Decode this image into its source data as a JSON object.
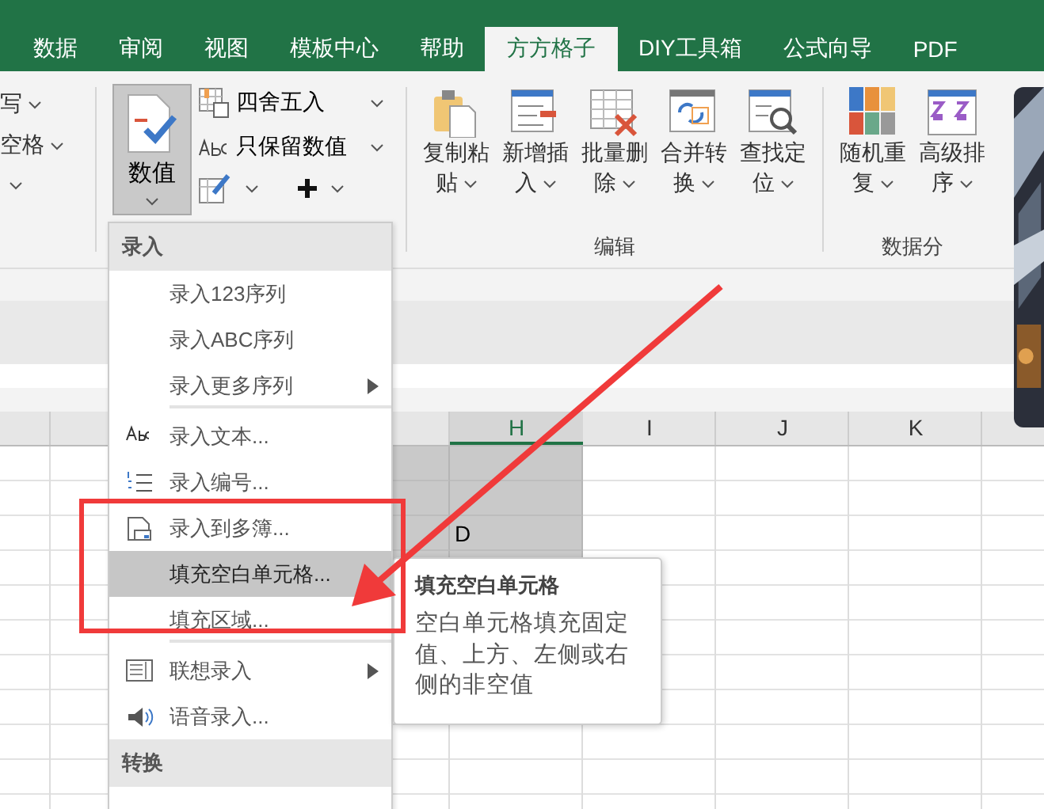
{
  "tabs": [
    {
      "label": "数据",
      "selected": false
    },
    {
      "label": "审阅",
      "selected": false
    },
    {
      "label": "视图",
      "selected": false
    },
    {
      "label": "模板中心",
      "selected": false
    },
    {
      "label": "帮助",
      "selected": false
    },
    {
      "label": "方方格子",
      "selected": true
    },
    {
      "label": "DIY工具箱",
      "selected": false
    },
    {
      "label": "公式向导",
      "selected": false
    },
    {
      "label": "PDF",
      "selected": false
    }
  ],
  "ribbon": {
    "cut_items": [
      "写",
      "空格"
    ],
    "value_button": {
      "label": "数值",
      "pressed": true
    },
    "small_buttons": [
      {
        "label": "四舍五入"
      },
      {
        "label": "只保留数值"
      }
    ],
    "groups": [
      {
        "label": "编辑",
        "buttons": [
          "复制粘贴",
          "新增插入",
          "批量删除",
          "合并转换",
          "查找定位"
        ]
      },
      {
        "label": "数据分",
        "buttons": [
          "随机重复",
          "高级排序"
        ]
      }
    ]
  },
  "grid": {
    "columns": [
      "H",
      "I",
      "J",
      "K"
    ],
    "rows": [
      {
        "selected": true
      },
      {
        "selected": true
      },
      {
        "selected": true,
        "column_h": "D"
      },
      {
        "selected": true
      }
    ]
  },
  "menu": {
    "sections": [
      {
        "title": "录入",
        "items": [
          {
            "label": "录入123序列",
            "kind": "plain",
            "submenu": false,
            "selected": false,
            "separator_after": false
          },
          {
            "label": "录入ABC序列",
            "kind": "plain",
            "submenu": false,
            "selected": false,
            "separator_after": false
          },
          {
            "label": "录入更多序列",
            "kind": "plain",
            "submenu": true,
            "selected": false,
            "separator_after": true
          },
          {
            "label": "录入文本...",
            "kind": "text",
            "submenu": false,
            "selected": false,
            "separator_after": false
          },
          {
            "label": "录入编号...",
            "kind": "numbering",
            "submenu": false,
            "selected": false,
            "separator_after": false
          },
          {
            "label": "录入到多簿...",
            "kind": "workbook",
            "submenu": false,
            "selected": false,
            "separator_after": false
          },
          {
            "label": "填充空白单元格...",
            "kind": "plain",
            "submenu": false,
            "selected": true,
            "separator_after": false
          },
          {
            "label": "填充区域...",
            "kind": "plain",
            "submenu": false,
            "selected": false,
            "separator_after": true
          },
          {
            "label": "联想录入",
            "kind": "association",
            "submenu": true,
            "selected": false,
            "separator_after": false
          },
          {
            "label": "语音录入...",
            "kind": "voice",
            "submenu": false,
            "selected": false,
            "separator_after": false
          }
        ]
      },
      {
        "title": "转换"
      }
    ]
  },
  "tooltip": {
    "title": "填充空白单元格",
    "text": "空白单元格填充固定值、上方、左侧或右侧的非空值"
  }
}
